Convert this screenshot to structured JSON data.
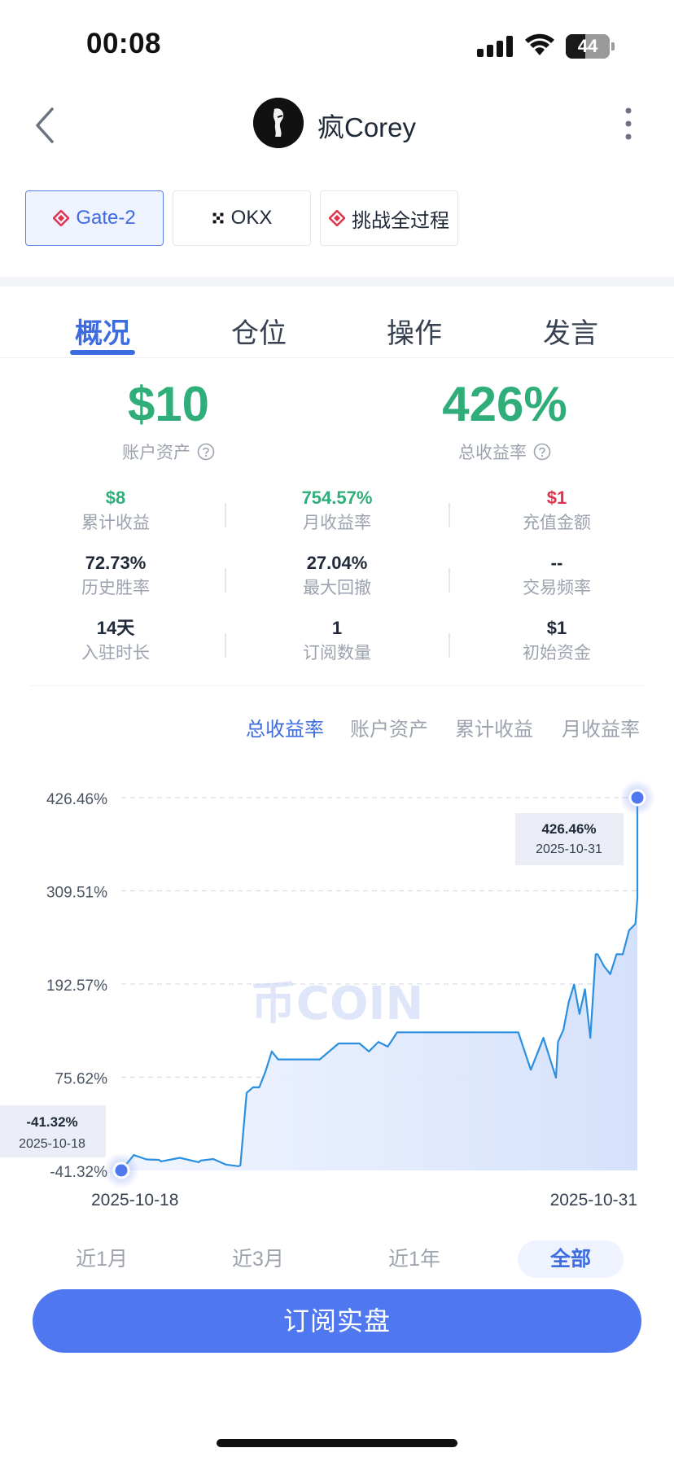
{
  "status_bar": {
    "time": "00:08",
    "battery": "44",
    "battery_level": 0.44
  },
  "header": {
    "title": "疯Corey",
    "back_icon": "chevron-left-icon",
    "more_icon": "more-vertical-icon"
  },
  "platforms": [
    {
      "label": "Gate-2",
      "icon": "gate-diamond-icon",
      "active": true
    },
    {
      "label": "OKX",
      "icon": "okx-logo-icon",
      "active": false
    },
    {
      "label": "挑战全过程",
      "icon": "gate-diamond-icon",
      "active": false
    }
  ],
  "main_tabs": [
    {
      "label": "概况",
      "active": true
    },
    {
      "label": "仓位",
      "active": false
    },
    {
      "label": "操作",
      "active": false
    },
    {
      "label": "发言",
      "active": false
    }
  ],
  "summary": {
    "account_assets": {
      "value": "$10",
      "label": "账户资产"
    },
    "total_return": {
      "value": "426%",
      "label": "总收益率"
    }
  },
  "stats": [
    {
      "value": "$8",
      "label": "累计收益",
      "color": "green"
    },
    {
      "value": "754.57%",
      "label": "月收益率",
      "color": "green"
    },
    {
      "value": "$1",
      "label": "充值金额",
      "color": "red"
    },
    {
      "value": "72.73%",
      "label": "历史胜率",
      "color": "default"
    },
    {
      "value": "27.04%",
      "label": "最大回撤",
      "color": "default"
    },
    {
      "value": "--",
      "label": "交易频率",
      "color": "default"
    },
    {
      "value": "14天",
      "label": "入驻时长",
      "color": "default"
    },
    {
      "value": "1",
      "label": "订阅数量",
      "color": "default"
    },
    {
      "value": "$1",
      "label": "初始资金",
      "color": "default"
    }
  ],
  "metric_tabs": [
    {
      "label": "总收益率",
      "active": true
    },
    {
      "label": "账户资产",
      "active": false
    },
    {
      "label": "累计收益",
      "active": false
    },
    {
      "label": "月收益率",
      "active": false
    }
  ],
  "chart_data": {
    "type": "line",
    "ytick_labels": [
      "426.46%",
      "309.51%",
      "192.57%",
      "75.62%",
      "-41.32%"
    ],
    "ylim": [
      -41.32,
      426.46
    ],
    "xtick_labels": [
      "2025-10-18",
      "2025-10-31"
    ],
    "x_start": "2025-10-18",
    "x_end": "2025-10-31",
    "grid": true,
    "watermark": "币COIN",
    "start_tooltip": {
      "value": "-41.32%",
      "date": "2025-10-18"
    },
    "end_tooltip": {
      "value": "426.46%",
      "date": "2025-10-31"
    },
    "series": [
      {
        "x": [
          "2025-10-18",
          "2025-10-18",
          "2025-10-18",
          "2025-10-18",
          "2025-10-19",
          "2025-10-19",
          "2025-10-19",
          "2025-10-20",
          "2025-10-20",
          "2025-10-20",
          "2025-10-20",
          "2025-10-21",
          "2025-10-21",
          "2025-10-21",
          "2025-10-21",
          "2025-10-21",
          "2025-10-21",
          "2025-10-21",
          "2025-10-22",
          "2025-10-22",
          "2025-10-23",
          "2025-10-23",
          "2025-10-23",
          "2025-10-24",
          "2025-10-24",
          "2025-10-24",
          "2025-10-24",
          "2025-10-24",
          "2025-10-25",
          "2025-10-25",
          "2025-10-28",
          "2025-10-28",
          "2025-10-28",
          "2025-10-28",
          "2025-10-29",
          "2025-10-29",
          "2025-10-29",
          "2025-10-29",
          "2025-10-29",
          "2025-10-29",
          "2025-10-29",
          "2025-10-29",
          "2025-10-30",
          "2025-10-30",
          "2025-10-30",
          "2025-10-30",
          "2025-10-30",
          "2025-10-30",
          "2025-10-30",
          "2025-10-31",
          "2025-10-31",
          "2025-10-31",
          "2025-10-31"
        ],
        "y": [
          -41.32,
          -22.0,
          -27.5,
          -28.0,
          -30.0,
          -25.5,
          -31.0,
          -29.0,
          -27.0,
          -34.0,
          -36.0,
          -35.0,
          56.0,
          63.0,
          63.0,
          83.0,
          108.0,
          98.0,
          98.0,
          98.0,
          98.0,
          118.0,
          118.0,
          118.0,
          108.0,
          120.0,
          114.0,
          132.0,
          132.0,
          132.0,
          132.0,
          85.0,
          125.0,
          75.0,
          120.0,
          135.0,
          170.0,
          192.0,
          155.0,
          186.0,
          125.0,
          230.0,
          230.0,
          215.0,
          205.0,
          230.0,
          230.0,
          260.0,
          268.0,
          300.0,
          350.0,
          426.46,
          426.46
        ]
      }
    ]
  },
  "period_tabs": [
    {
      "label": "近1月",
      "active": false
    },
    {
      "label": "近3月",
      "active": false
    },
    {
      "label": "近1年",
      "active": false
    },
    {
      "label": "全部",
      "active": true
    }
  ],
  "subscribe_label": "订阅实盘",
  "colors": {
    "accent": "#3d6be0",
    "green": "#2fae7a",
    "red": "#e0334b",
    "line": "#2b8fe0",
    "button": "#4f78f0"
  }
}
